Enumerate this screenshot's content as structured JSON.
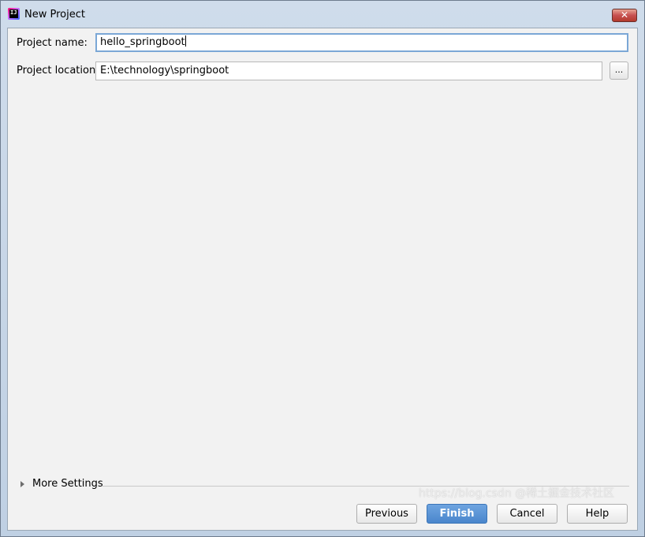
{
  "window": {
    "title": "New Project",
    "close_glyph": "✕"
  },
  "form": {
    "project_name_label": "Project name:",
    "project_name_value": "hello_springboot",
    "project_location_label": "Project location:",
    "project_location_value": "E:\\technology\\springboot",
    "browse_label": "..."
  },
  "more_settings": {
    "label": "More Settings",
    "expanded": false
  },
  "buttons": {
    "previous": "Previous",
    "finish": "Finish",
    "cancel": "Cancel",
    "help": "Help"
  },
  "watermark": {
    "text": "https://blog.csdn @稀土掘金技术社区"
  },
  "colors": {
    "primary_button": "#4a86cc",
    "focus_border": "#7ba7d6",
    "close_button": "#c75050"
  }
}
